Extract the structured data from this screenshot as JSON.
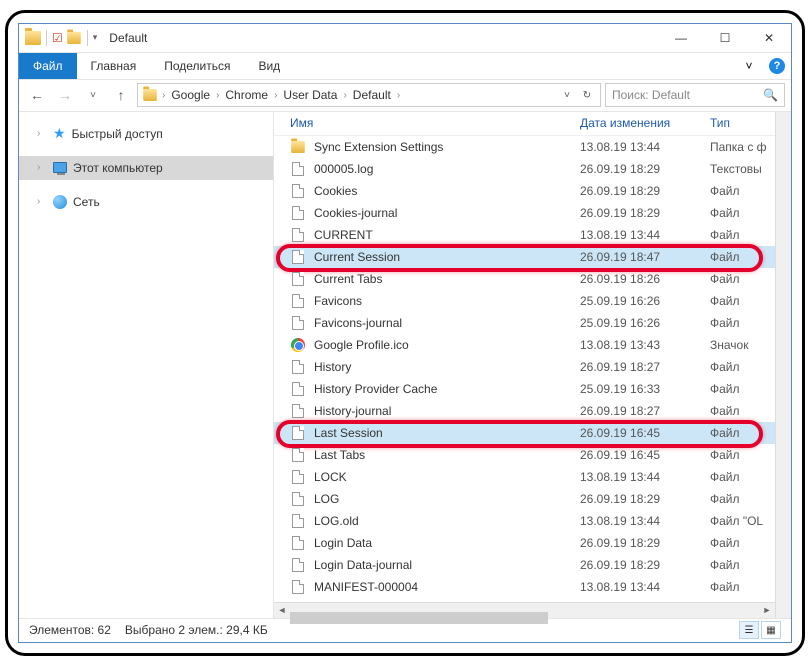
{
  "window": {
    "title": "Default"
  },
  "ribbon": {
    "file": "Файл",
    "tabs": [
      "Главная",
      "Поделиться",
      "Вид"
    ]
  },
  "breadcrumb": [
    "Google",
    "Chrome",
    "User Data",
    "Default"
  ],
  "search": {
    "placeholder": "Поиск: Default"
  },
  "nav": {
    "quick": "Быстрый доступ",
    "pc": "Этот компьютер",
    "net": "Сеть"
  },
  "columns": {
    "name": "Имя",
    "date": "Дата изменения",
    "type": "Тип"
  },
  "files": [
    {
      "name": "Sync Extension Settings",
      "date": "13.08.19 13:44",
      "type": "Папка с ф",
      "icon": "folder",
      "selected": false
    },
    {
      "name": "000005.log",
      "date": "26.09.19 18:29",
      "type": "Текстовы",
      "icon": "file",
      "selected": false
    },
    {
      "name": "Cookies",
      "date": "26.09.19 18:29",
      "type": "Файл",
      "icon": "file",
      "selected": false
    },
    {
      "name": "Cookies-journal",
      "date": "26.09.19 18:29",
      "type": "Файл",
      "icon": "file",
      "selected": false
    },
    {
      "name": "CURRENT",
      "date": "13.08.19 13:44",
      "type": "Файл",
      "icon": "file",
      "selected": false
    },
    {
      "name": "Current Session",
      "date": "26.09.19 18:47",
      "type": "Файл",
      "icon": "file",
      "selected": true
    },
    {
      "name": "Current Tabs",
      "date": "26.09.19 18:26",
      "type": "Файл",
      "icon": "file",
      "selected": false
    },
    {
      "name": "Favicons",
      "date": "25.09.19 16:26",
      "type": "Файл",
      "icon": "file",
      "selected": false
    },
    {
      "name": "Favicons-journal",
      "date": "25.09.19 16:26",
      "type": "Файл",
      "icon": "file",
      "selected": false
    },
    {
      "name": "Google Profile.ico",
      "date": "13.08.19 13:43",
      "type": "Значок",
      "icon": "chrome",
      "selected": false
    },
    {
      "name": "History",
      "date": "26.09.19 18:27",
      "type": "Файл",
      "icon": "file",
      "selected": false
    },
    {
      "name": "History Provider Cache",
      "date": "25.09.19 16:33",
      "type": "Файл",
      "icon": "file",
      "selected": false
    },
    {
      "name": "History-journal",
      "date": "26.09.19 18:27",
      "type": "Файл",
      "icon": "file",
      "selected": false
    },
    {
      "name": "Last Session",
      "date": "26.09.19 16:45",
      "type": "Файл",
      "icon": "file",
      "selected": true
    },
    {
      "name": "Last Tabs",
      "date": "26.09.19 16:45",
      "type": "Файл",
      "icon": "file",
      "selected": false
    },
    {
      "name": "LOCK",
      "date": "13.08.19 13:44",
      "type": "Файл",
      "icon": "file",
      "selected": false
    },
    {
      "name": "LOG",
      "date": "26.09.19 18:29",
      "type": "Файл",
      "icon": "file",
      "selected": false
    },
    {
      "name": "LOG.old",
      "date": "13.08.19 13:44",
      "type": "Файл \"OL",
      "icon": "file",
      "selected": false
    },
    {
      "name": "Login Data",
      "date": "26.09.19 18:29",
      "type": "Файл",
      "icon": "file",
      "selected": false
    },
    {
      "name": "Login Data-journal",
      "date": "26.09.19 18:29",
      "type": "Файл",
      "icon": "file",
      "selected": false
    },
    {
      "name": "MANIFEST-000004",
      "date": "13.08.19 13:44",
      "type": "Файл",
      "icon": "file",
      "selected": false
    }
  ],
  "status": {
    "elements": "Элементов: 62",
    "selected": "Выбрано 2 элем.: 29,4 КБ"
  }
}
